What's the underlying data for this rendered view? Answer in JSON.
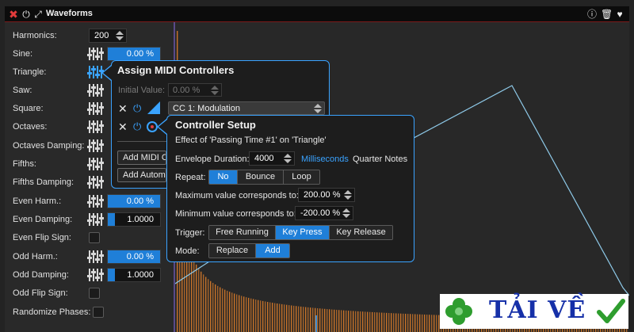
{
  "window": {
    "title": "Waveforms",
    "icons": [
      "close-icon",
      "power-icon",
      "expand-icon",
      "info-icon",
      "trash-icon",
      "heart-icon"
    ]
  },
  "params": {
    "harmonics": {
      "label": "Harmonics:",
      "value": "200"
    },
    "sine": {
      "label": "Sine:",
      "value": "0.00 %"
    },
    "triangle": {
      "label": "Triangle:"
    },
    "saw": {
      "label": "Saw:"
    },
    "square": {
      "label": "Square:"
    },
    "octaves": {
      "label": "Octaves:"
    },
    "octaves_damping": {
      "label": "Octaves Damping:"
    },
    "fifths": {
      "label": "Fifths:"
    },
    "fifths_damping": {
      "label": "Fifths Damping:"
    },
    "even_harm": {
      "label": "Even Harm.:",
      "value": "0.00 %"
    },
    "even_damping": {
      "label": "Even Damping:",
      "value": "1.0000"
    },
    "even_flip": {
      "label": "Even Flip Sign:"
    },
    "odd_harm": {
      "label": "Odd Harm.:",
      "value": "0.00 %"
    },
    "odd_damping": {
      "label": "Odd Damping:",
      "value": "1.0000"
    },
    "odd_flip": {
      "label": "Odd Flip Sign:"
    },
    "randomize": {
      "label": "Randomize Phases:"
    }
  },
  "midi_popup": {
    "title": "Assign MIDI Controllers",
    "initial_value_label": "Initial Value:",
    "initial_value": "0.00 %",
    "cc_selected": "CC 1: Modulation",
    "add_midi_label": "Add MIDI C",
    "add_auto_label": "Add Automa"
  },
  "controller_setup": {
    "title": "Controller Setup",
    "subtitle": "Effect of 'Passing Time #1' on 'Triangle'",
    "envelope_label": "Envelope Duration:",
    "envelope_value": "4000",
    "unit_milliseconds": "Milliseconds",
    "unit_quarter": "Quarter Notes",
    "repeat_label": "Repeat:",
    "repeat_options": [
      "No",
      "Bounce",
      "Loop"
    ],
    "repeat_selected": "No",
    "max_label": "Maximum value corresponds to:",
    "max_value": "200.00 %",
    "min_label": "Minimum value corresponds to:",
    "min_value": "-200.00 %",
    "trigger_label": "Trigger:",
    "trigger_options": [
      "Free Running",
      "Key Press",
      "Key Release"
    ],
    "trigger_selected": "Key Press",
    "mode_label": "Mode:",
    "mode_options": [
      "Replace",
      "Add"
    ],
    "mode_selected": "Add"
  },
  "watermark": {
    "text": "TẢI VỀ"
  },
  "colors": {
    "accent": "#3aa3ff",
    "selected": "#1f7fd8",
    "bars": "#c9742a",
    "wave": "#8ec9e8",
    "close": "#e23b3b"
  }
}
